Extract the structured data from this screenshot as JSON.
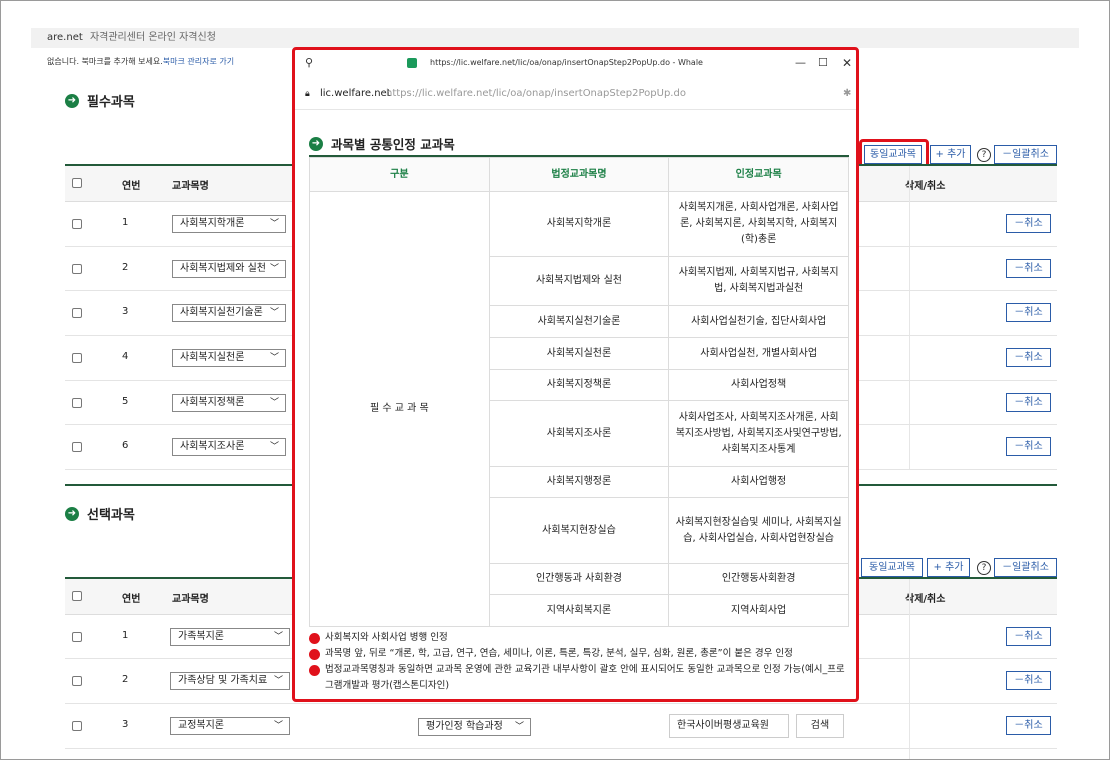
{
  "topbar": {
    "site": "are.net",
    "path": "자격관리센터 온라인 자격신청"
  },
  "bookmark": {
    "text": "없습니다. 북마크를 추가해 보세요.",
    "link": "북마크 관리자로 가기"
  },
  "required": {
    "title": "필수과목",
    "buttons": {
      "same": "동일교과목",
      "add": "+ 추가",
      "help": "?",
      "cancel_all": "－일괄취소"
    },
    "headers": {
      "num": "연번",
      "course": "교과목명",
      "action": "삭제/취소"
    },
    "rows": [
      {
        "num": "1",
        "course": "사회복지학개론",
        "cancel": "－취소"
      },
      {
        "num": "2",
        "course": "사회복지법제와 실천",
        "cancel": "－취소"
      },
      {
        "num": "3",
        "course": "사회복지실천기술론",
        "cancel": "－취소"
      },
      {
        "num": "4",
        "course": "사회복지실천론",
        "cancel": "－취소"
      },
      {
        "num": "5",
        "course": "사회복지정책론",
        "cancel": "－취소"
      },
      {
        "num": "6",
        "course": "사회복지조사론",
        "cancel": "－취소"
      }
    ]
  },
  "elective": {
    "title": "선택과목",
    "buttons": {
      "same": "동일교과목",
      "add": "+ 추가",
      "help": "?",
      "cancel_all": "－일괄취소"
    },
    "headers": {
      "num": "연번",
      "course": "교과목명",
      "action": "삭제/취소"
    },
    "rows": [
      {
        "num": "1",
        "course": "가족복지론",
        "cancel": "－취소"
      },
      {
        "num": "2",
        "course": "가족상담 및 가족치료",
        "cancel": "－취소"
      },
      {
        "num": "3",
        "course": "교정복지론",
        "cancel": "－취소",
        "type": "평가인정 학습과정",
        "school": "한국사이버평생교육원",
        "search": "검색"
      }
    ]
  },
  "popup": {
    "window_title": "https://lic.welfare.net/lic/oa/onap/insertOnapStep2PopUp.do - Whale",
    "domain": "lic.welfare.net",
    "url": "https://lic.welfare.net/lic/oa/onap/insertOnapStep2PopUp.do",
    "heading": "과목별 공통인정 교과목",
    "table_headers": {
      "category": "구분",
      "legal": "법정교과목명",
      "recognized": "인정교과목"
    },
    "category": "필 수 교 과 목",
    "rows": [
      {
        "legal": "사회복지학개론",
        "recognized": "사회복지개론, 사회사업개론, 사회사업론, 사회복지론, 사회복지학, 사회복지(학)총론"
      },
      {
        "legal": "사회복지법제와 실천",
        "recognized": "사회복지법제, 사회복지법규, 사회복지법, 사회복지법과실천"
      },
      {
        "legal": "사회복지실천기술론",
        "recognized": "사회사업실천기술, 집단사회사업"
      },
      {
        "legal": "사회복지실천론",
        "recognized": "사회사업실천, 개별사회사업"
      },
      {
        "legal": "사회복지정책론",
        "recognized": "사회사업정책"
      },
      {
        "legal": "사회복지조사론",
        "recognized": "사회사업조사, 사회복지조사개론, 사회복지조사방법, 사회복지조사및연구방법, 사회복지조사통계"
      },
      {
        "legal": "사회복지행정론",
        "recognized": "사회사업행정"
      },
      {
        "legal": "사회복지현장실습",
        "recognized": "사회복지현장실습및 세미나, 사회복지실습, 사회사업실습, 사회사업현장실습"
      },
      {
        "legal": "인간행동과 사회환경",
        "recognized": "인간행동사회환경"
      },
      {
        "legal": "지역사회복지론",
        "recognized": "지역사회사업"
      }
    ],
    "notes": [
      "사회복지와 사회사업 병행 인정",
      "과목명 앞, 뒤로 “개론, 학, 고급, 연구, 연습, 세미나, 이론, 특론, 특강, 분석, 실무, 심화, 원론, 총론”이 붙은 경우 인정",
      "법정교과목명칭과 동일하면 교과목 운영에 관한 교육기관 내부사항이 괄호 안에 표시되어도 동일한 교과목으로 인정 가능(예시_프로그램개발과 평가(캡스톤디자인)"
    ]
  }
}
